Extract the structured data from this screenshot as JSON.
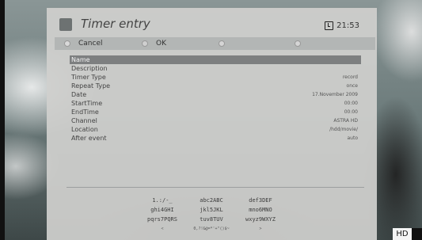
{
  "header": {
    "title": "Timer entry",
    "clock": "21:53"
  },
  "buttons": [
    {
      "label": "Cancel"
    },
    {
      "label": "OK"
    },
    {
      "label": ""
    },
    {
      "label": ""
    }
  ],
  "fields": [
    {
      "label": "Name",
      "value": ""
    },
    {
      "label": "Description",
      "value": ""
    },
    {
      "label": "Timer Type",
      "value": "record"
    },
    {
      "label": "Repeat Type",
      "value": "once"
    },
    {
      "label": "Date",
      "value": "17.November 2009"
    },
    {
      "label": "StartTime",
      "value": "00:00"
    },
    {
      "label": "EndTime",
      "value": "00:00"
    },
    {
      "label": "Channel",
      "value": "ASTRA HD"
    },
    {
      "label": "Location",
      "value": "/hdd/movie/"
    },
    {
      "label": "After event",
      "value": "auto"
    }
  ],
  "keyboard": {
    "row1": [
      "1.:/-_",
      "abc2ABC",
      "def3DEF"
    ],
    "row2": [
      "ghi4GHI",
      "jkl5JKL",
      "mno6MNO"
    ],
    "row3": [
      "pqrs7PQRS",
      "tuv8TUV",
      "wxyz9WXYZ"
    ],
    "row4": [
      "<",
      "0,?!&@=*'+\"()$~",
      ">"
    ]
  },
  "badge": "HD"
}
